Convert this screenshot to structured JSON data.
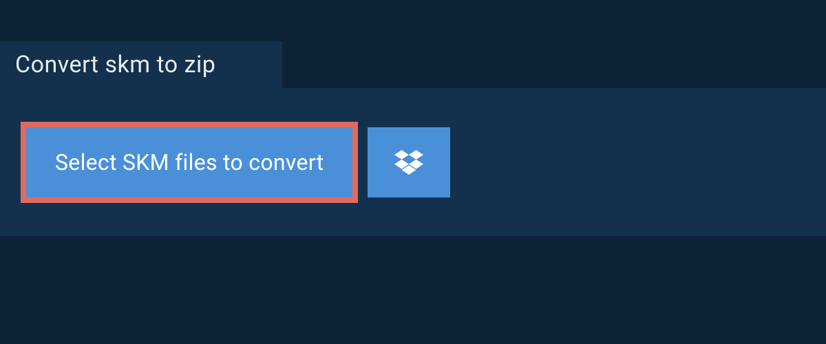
{
  "tab": {
    "title": "Convert skm to zip"
  },
  "actions": {
    "select_files_label": "Select SKM files to convert",
    "dropbox_icon": "dropbox-icon"
  },
  "colors": {
    "background": "#0d2438",
    "panel": "#13314d",
    "highlight": "#e16a5d",
    "button": "#4a90d9"
  }
}
